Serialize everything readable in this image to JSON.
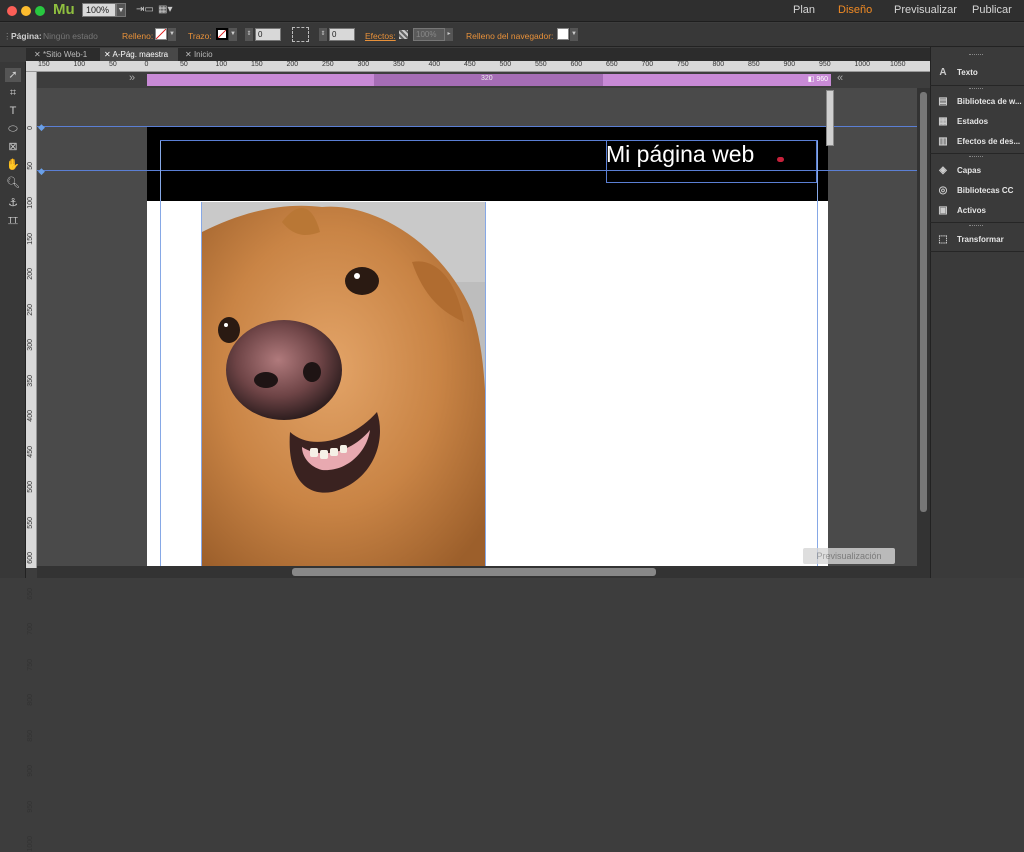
{
  "app": {
    "logo": "Mu",
    "zoom": "100%"
  },
  "modes": [
    {
      "label": "Plan",
      "active": false
    },
    {
      "label": "Diseño",
      "active": true
    },
    {
      "label": "Previsualizar",
      "active": false
    },
    {
      "label": "Publicar",
      "active": false
    }
  ],
  "control": {
    "page_label": "Página:",
    "page_state": "Ningún estado",
    "fill_label": "Relleno:",
    "stroke_label": "Trazo:",
    "stroke_value": "0",
    "corner_value": "0",
    "effects_label": "Efectos:",
    "effects_value": "100%",
    "browser_fill_label": "Relleno del navegador:"
  },
  "tabs": [
    {
      "label": "*Sitio Web-1",
      "active": false
    },
    {
      "label": "A-Pág. maestra",
      "active": true
    },
    {
      "label": "Inicio",
      "active": false
    }
  ],
  "ruler": {
    "h_ticks": [
      "150",
      "100",
      "50",
      "0",
      "50",
      "100",
      "150",
      "200",
      "250",
      "300",
      "350",
      "400",
      "450",
      "500",
      "550",
      "600",
      "650",
      "700",
      "750",
      "800",
      "850",
      "900",
      "950",
      "1000",
      "1050"
    ],
    "v_ticks": [
      "0",
      "50",
      "100",
      "150",
      "200",
      "250",
      "300",
      "350",
      "400",
      "450",
      "500",
      "550",
      "600",
      "650",
      "700",
      "750",
      "800",
      "850",
      "900",
      "950",
      "1000"
    ]
  },
  "breakpoints": {
    "mid_label": "320",
    "max_label": "960"
  },
  "canvas": {
    "site_title": "Mi página web",
    "accent_color": "#c8213b",
    "header_color": "#000000",
    "image_alt": "Foto de perro golden retriever"
  },
  "preview_button": "Previsualización",
  "panels": [
    {
      "icon": "text-icon",
      "glyph": "A",
      "label": "Texto"
    },
    {
      "icon": "widgets-library-icon",
      "glyph": "▤",
      "label": "Biblioteca de w..."
    },
    {
      "icon": "states-icon",
      "glyph": "▦",
      "label": "Estados"
    },
    {
      "icon": "scroll-effects-icon",
      "glyph": "▥",
      "label": "Efectos de des..."
    },
    {
      "icon": "layers-icon",
      "glyph": "◈",
      "label": "Capas"
    },
    {
      "icon": "cc-libraries-icon",
      "glyph": "◎",
      "label": "Bibliotecas CC"
    },
    {
      "icon": "assets-icon",
      "glyph": "▣",
      "label": "Activos"
    },
    {
      "icon": "transform-icon",
      "glyph": "⬚",
      "label": "Transformar"
    }
  ]
}
